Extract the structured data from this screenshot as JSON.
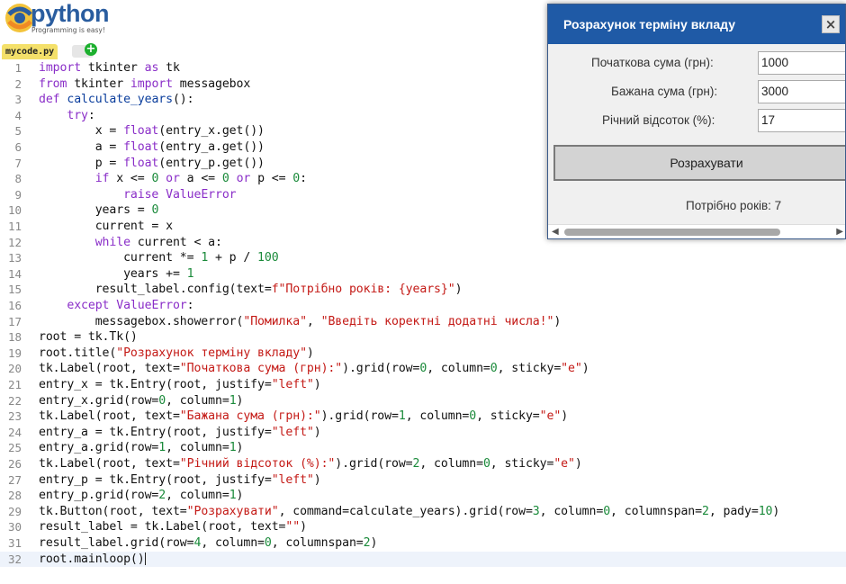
{
  "logo": {
    "name": "python",
    "tagline": "Programming is easy!"
  },
  "tab": {
    "filename": "mycode.py"
  },
  "dialog": {
    "title": "Розрахунок терміну вкладу",
    "close_icon": "close-icon",
    "fields": [
      {
        "label": "Початкова сума (грн):",
        "value": "1000"
      },
      {
        "label": "Бажана сума (грн):",
        "value": "3000"
      },
      {
        "label": "Річний відсоток (%):",
        "value": "17"
      }
    ],
    "button": "Розрахувати",
    "result": "Потрібно років: 7"
  },
  "code": [
    "import tkinter as tk",
    "from tkinter import messagebox",
    "def calculate_years():",
    "    try:",
    "        x = float(entry_x.get())",
    "        a = float(entry_a.get())",
    "        p = float(entry_p.get())",
    "        if x <= 0 or a <= 0 or p <= 0:",
    "            raise ValueError",
    "        years = 0",
    "        current = x",
    "        while current < a:",
    "            current *= 1 + p / 100",
    "            years += 1",
    "        result_label.config(text=f\"Потрібно років: {years}\")",
    "    except ValueError:",
    "        messagebox.showerror(\"Помилка\", \"Введіть коректні додатні числа!\")",
    "root = tk.Tk()",
    "root.title(\"Розрахунок терміну вкладу\")",
    "tk.Label(root, text=\"Початкова сума (грн):\").grid(row=0, column=0, sticky=\"e\")",
    "entry_x = tk.Entry(root, justify=\"left\")",
    "entry_x.grid(row=0, column=1)",
    "tk.Label(root, text=\"Бажана сума (грн):\").grid(row=1, column=0, sticky=\"e\")",
    "entry_a = tk.Entry(root, justify=\"left\")",
    "entry_a.grid(row=1, column=1)",
    "tk.Label(root, text=\"Річний відсоток (%):\").grid(row=2, column=0, sticky=\"e\")",
    "entry_p = tk.Entry(root, justify=\"left\")",
    "entry_p.grid(row=2, column=1)",
    "tk.Button(root, text=\"Розрахувати\", command=calculate_years).grid(row=3, column=0, columnspan=2, pady=10)",
    "result_label = tk.Label(root, text=\"\")",
    "result_label.grid(row=4, column=0, columnspan=2)",
    "root.mainloop()"
  ],
  "active_line": 32
}
